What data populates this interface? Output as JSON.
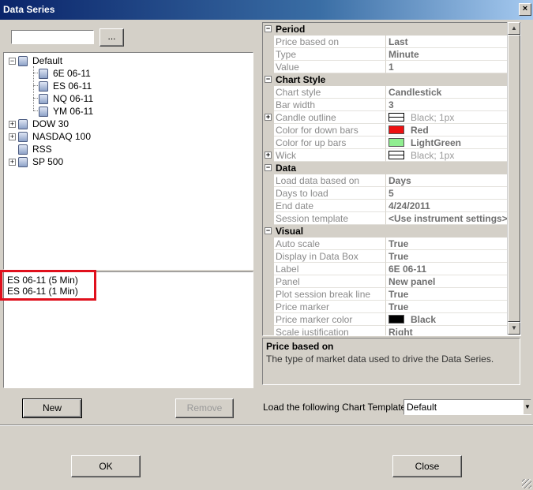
{
  "window": {
    "title": "Data Series",
    "close_glyph": "×"
  },
  "search": {
    "value": "",
    "browse_label": "..."
  },
  "tree": {
    "nodes": [
      {
        "label": "Default",
        "expander": "−"
      },
      {
        "label": "6E 06-11"
      },
      {
        "label": "ES 06-11"
      },
      {
        "label": "NQ 06-11"
      },
      {
        "label": "YM 06-11"
      },
      {
        "label": "DOW 30",
        "expander": "+"
      },
      {
        "label": "NASDAQ 100",
        "expander": "+"
      },
      {
        "label": "RSS"
      },
      {
        "label": "SP 500",
        "expander": "+"
      }
    ]
  },
  "series_list": {
    "items": [
      "ES 06-11 (5 Min)",
      "ES 06-11 (1 Min)"
    ]
  },
  "buttons": {
    "new": "New",
    "remove": "Remove",
    "ok": "OK",
    "close": "Close"
  },
  "grid": {
    "period_cat": "Period",
    "price_based_on": {
      "name": "Price based on",
      "value": "Last"
    },
    "type": {
      "name": "Type",
      "value": "Minute"
    },
    "value": {
      "name": "Value",
      "value": "1"
    },
    "chart_style_cat": "Chart Style",
    "chart_style": {
      "name": "Chart style",
      "value": "Candlestick"
    },
    "bar_width": {
      "name": "Bar width",
      "value": "3"
    },
    "candle_outline": {
      "name": "Candle outline",
      "value": "Black; 1px"
    },
    "color_down": {
      "name": "Color for down bars",
      "value": "Red",
      "color": "#ee1010"
    },
    "color_up": {
      "name": "Color for up bars",
      "value": "LightGreen",
      "color": "#90ee90"
    },
    "wick": {
      "name": "Wick",
      "value": "Black; 1px"
    },
    "data_cat": "Data",
    "load_based_on": {
      "name": "Load data based on",
      "value": "Days"
    },
    "days_to_load": {
      "name": "Days to load",
      "value": "5"
    },
    "end_date": {
      "name": "End date",
      "value": "4/24/2011"
    },
    "session_template": {
      "name": "Session template",
      "value": "<Use instrument settings>"
    },
    "visual_cat": "Visual",
    "auto_scale": {
      "name": "Auto scale",
      "value": "True"
    },
    "display_data_box": {
      "name": "Display in Data Box",
      "value": "True"
    },
    "label": {
      "name": "Label",
      "value": "6E 06-11"
    },
    "panel": {
      "name": "Panel",
      "value": "New panel"
    },
    "plot_session_break": {
      "name": "Plot session break line",
      "value": "True"
    },
    "price_marker": {
      "name": "Price marker",
      "value": "True"
    },
    "price_marker_color": {
      "name": "Price marker color",
      "value": "Black",
      "color": "#000000"
    },
    "scale_justification": {
      "name": "Scale justification",
      "value": "Right"
    }
  },
  "description": {
    "title": "Price based on",
    "text": "The type of market data used to drive the Data Series."
  },
  "template": {
    "label": "Load the following Chart Template:",
    "selected": "Default"
  },
  "colors": {
    "highlight": "#e0101c",
    "titlebar_start": "#0a246a"
  }
}
